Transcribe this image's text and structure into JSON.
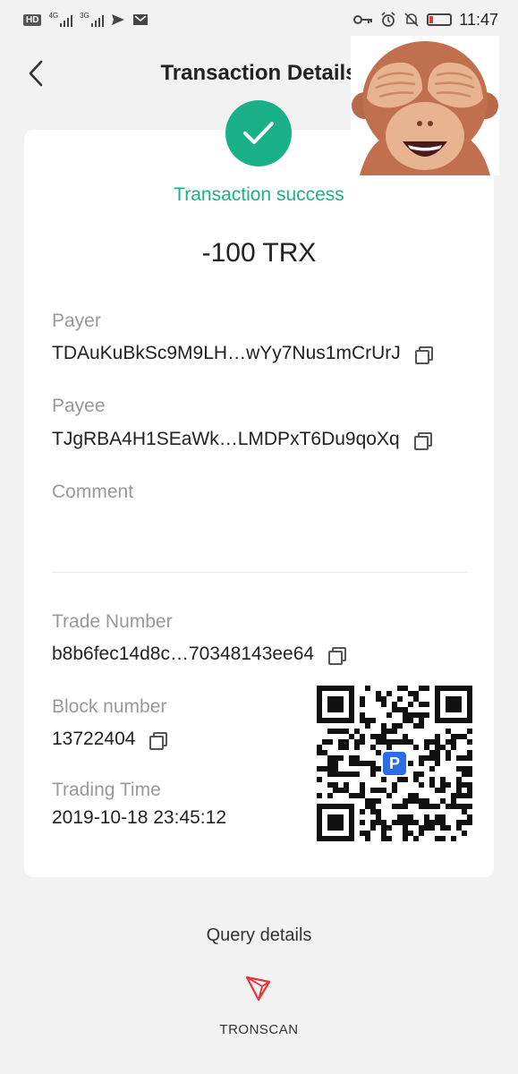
{
  "status_bar": {
    "hd_badge": "HD",
    "net1": "4G",
    "net2": "3G",
    "time": "11:47"
  },
  "header": {
    "title": "Transaction Details"
  },
  "transaction": {
    "status": "Transaction success",
    "amount": "-100 TRX",
    "payer_label": "Payer",
    "payer_value": "TDAuKuBkSc9M9LH…wYy7Nus1mCrUrJ",
    "payee_label": "Payee",
    "payee_value": "TJgRBA4H1SEaWk…LMDPxT6Du9qoXq",
    "comment_label": "Comment",
    "comment_value": "",
    "trade_number_label": "Trade Number",
    "trade_number_value": "b8b6fec14d8c…70348143ee64",
    "block_number_label": "Block number",
    "block_number_value": "13722404",
    "trading_time_label": "Trading Time",
    "trading_time_value": "2019-10-18 23:45:12"
  },
  "footer": {
    "query_details": "Query details",
    "tronscan_label": "TRONSCAN"
  },
  "colors": {
    "success": "#1ab187",
    "tron_red": "#e5343c",
    "qr_logo": "#2b6de5"
  }
}
